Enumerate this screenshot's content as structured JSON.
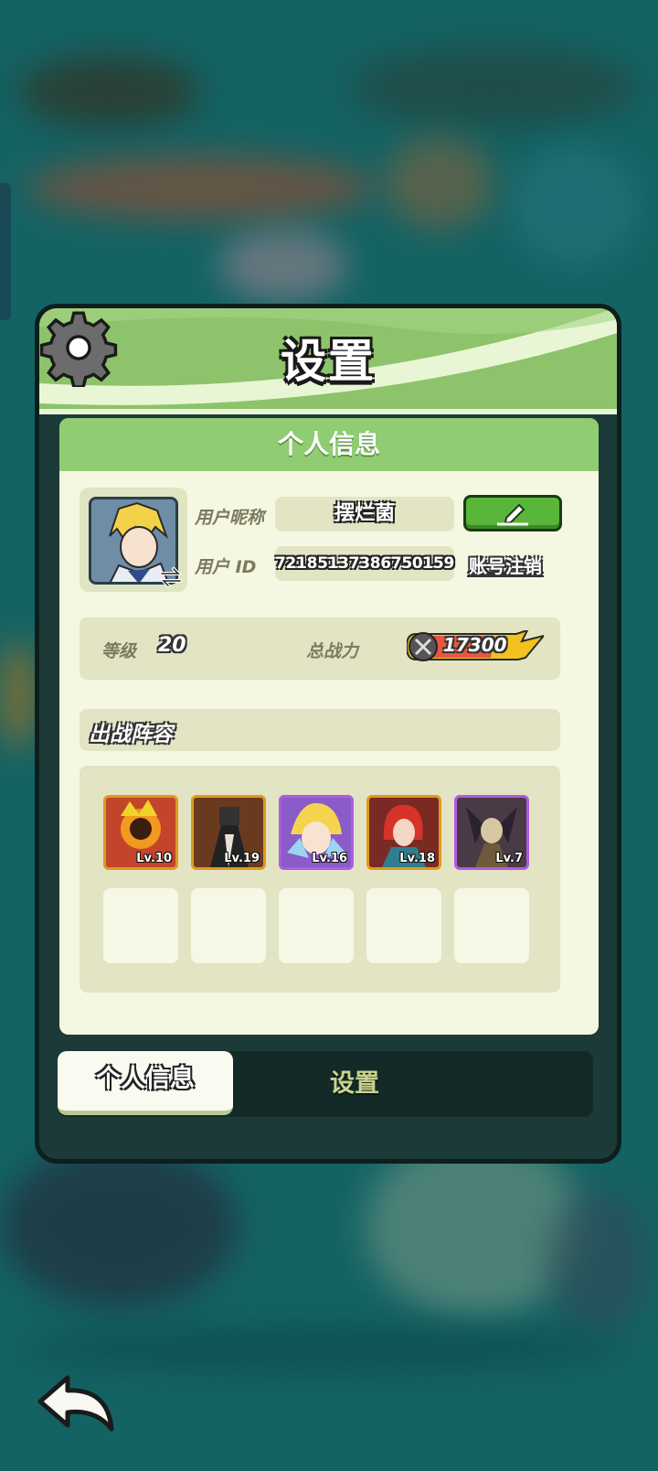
{
  "dialog": {
    "title": "设置",
    "section_title": "个人信息"
  },
  "profile": {
    "nickname_label": "用户昵称",
    "nickname": "摆烂菌",
    "uid_label": "用户 ID",
    "uid": "72185137386750159",
    "cancel_account": "账号注销",
    "level_label": "等级",
    "level": "20",
    "power_label": "总战力",
    "power": "17300"
  },
  "lineup": {
    "title": "出战阵容",
    "heroes": [
      {
        "lv": "Lv.10",
        "rarity": "orange"
      },
      {
        "lv": "Lv.19",
        "rarity": "orange"
      },
      {
        "lv": "Lv.16",
        "rarity": "purple"
      },
      {
        "lv": "Lv.18",
        "rarity": "orange"
      },
      {
        "lv": "Lv.7",
        "rarity": "purple"
      }
    ],
    "empty_slots": 5
  },
  "tabs": {
    "active": "个人信息",
    "other": "设置"
  },
  "colors": {
    "banner": "#8dc36a",
    "card": "#f4f8e2",
    "edit_button": "#59b63b",
    "orange_frame": "#e09a1e",
    "purple_frame": "#b05ce0"
  }
}
